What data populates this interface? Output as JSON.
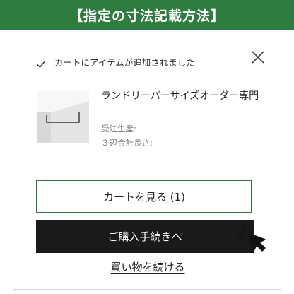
{
  "banner": {
    "title": "【指定の寸法記載方法】"
  },
  "notice": {
    "message": "カートにアイテムが追加されました"
  },
  "product": {
    "name": "ランドリーバーサイズオーダー専門",
    "meta_1": "受注生産:",
    "meta_2": "３辺合計長さ:"
  },
  "actions": {
    "view_cart": "カートを見る (1)",
    "checkout": "ご購入手続きへ",
    "continue": "買い物を続ける"
  },
  "colors": {
    "brand_green": "#2e7d3f",
    "checkout_bg": "#1a1a1a"
  },
  "icons": [
    "check-icon",
    "close-icon",
    "pointer-cursor-icon"
  ]
}
